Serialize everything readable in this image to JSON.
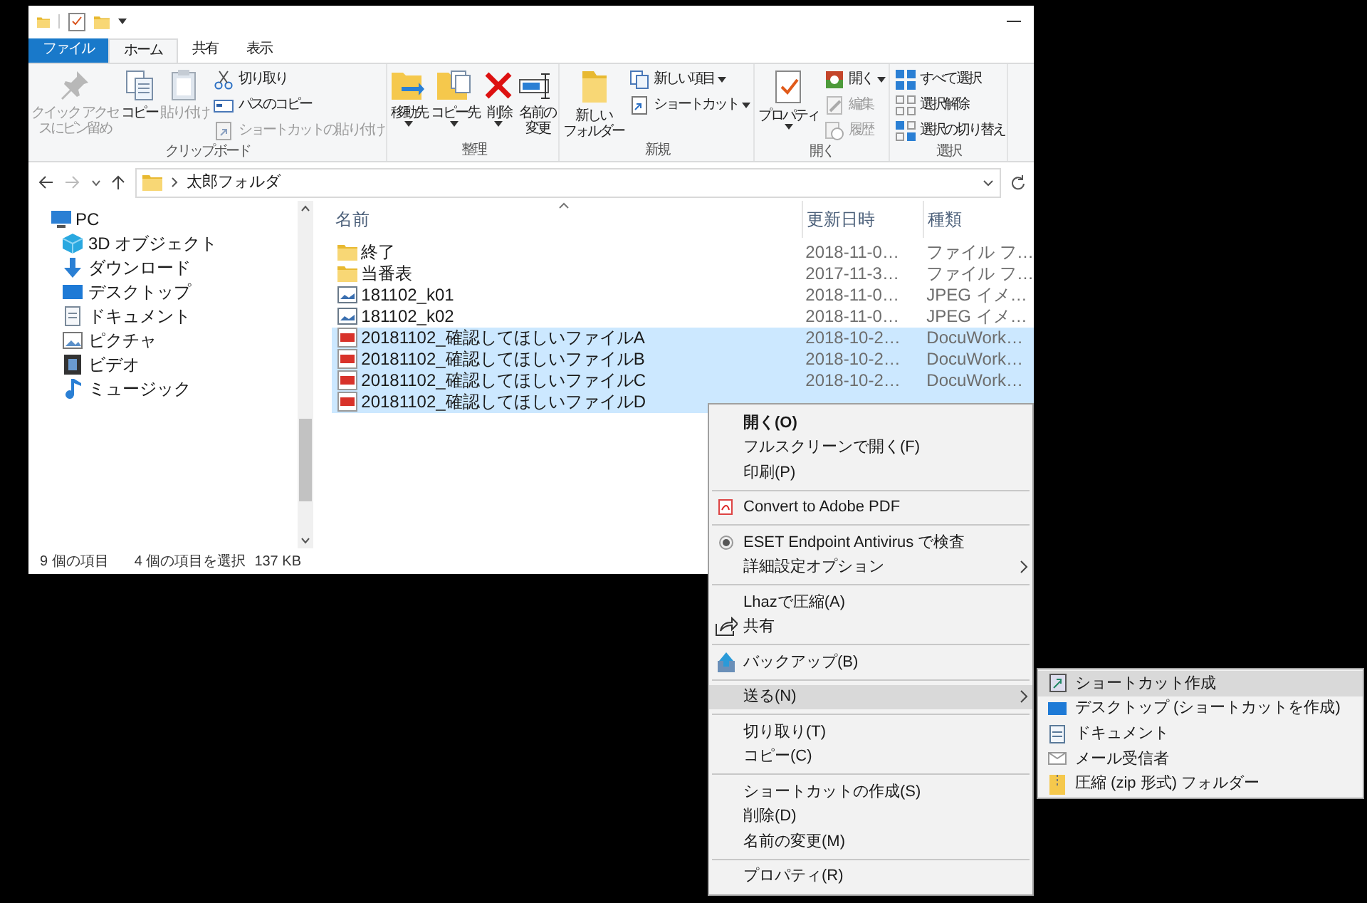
{
  "tabs": [
    {
      "label": "ファイル",
      "kind": "file",
      "selected": false
    },
    {
      "label": "ホーム",
      "kind": "tab",
      "selected": true
    },
    {
      "label": "共有",
      "kind": "tab",
      "selected": false
    },
    {
      "label": "表示",
      "kind": "tab",
      "selected": false
    }
  ],
  "ribbon": [
    {
      "label": "クリップボード",
      "items": [
        {
          "kind": "large",
          "label": [
            "クイック アクセ",
            "スにピン留め"
          ],
          "disabled": true,
          "dropdown": false
        },
        {
          "kind": "large",
          "label": [
            "コピー"
          ],
          "disabled": false,
          "dropdown": false
        },
        {
          "kind": "large",
          "label": [
            "貼り付け"
          ],
          "disabled": true,
          "dropdown": false
        },
        {
          "kind": "stack",
          "items": [
            {
              "label": "切り取り",
              "disabled": false,
              "dropdown": false
            },
            {
              "label": "パスのコピー",
              "disabled": false,
              "dropdown": false
            },
            {
              "label": "ショートカットの貼り付け",
              "disabled": true,
              "dropdown": false
            }
          ]
        }
      ]
    },
    {
      "label": "整理",
      "items": [
        {
          "kind": "large",
          "label": [
            "移動先"
          ],
          "disabled": false,
          "dropdown": true
        },
        {
          "kind": "large",
          "label": [
            "コピー先"
          ],
          "disabled": false,
          "dropdown": true
        },
        {
          "kind": "large",
          "label": [
            "削除"
          ],
          "disabled": false,
          "dropdown": true
        },
        {
          "kind": "large",
          "label": [
            "名前の",
            "変更"
          ],
          "disabled": false,
          "dropdown": false
        }
      ]
    },
    {
      "label": "新規",
      "items": [
        {
          "kind": "large",
          "label": [
            "新しい",
            "フォルダー"
          ],
          "disabled": false,
          "dropdown": false
        },
        {
          "kind": "stack",
          "items": [
            {
              "label": "新しい項目",
              "disabled": false,
              "dropdown": true
            },
            {
              "label": "ショートカット",
              "disabled": false,
              "dropdown": true
            }
          ]
        }
      ]
    },
    {
      "label": "開く",
      "items": [
        {
          "kind": "large",
          "label": [
            "プロパティ"
          ],
          "disabled": false,
          "dropdown": true
        },
        {
          "kind": "stack",
          "items": [
            {
              "label": "開く",
              "disabled": false,
              "dropdown": true
            },
            {
              "label": "編集",
              "disabled": true,
              "dropdown": false
            },
            {
              "label": "履歴",
              "disabled": true,
              "dropdown": false
            }
          ]
        }
      ]
    },
    {
      "label": "選択",
      "items": [
        {
          "kind": "stack",
          "items": [
            {
              "label": "すべて選択",
              "disabled": false,
              "dropdown": false
            },
            {
              "label": "選択解除",
              "disabled": false,
              "dropdown": false
            },
            {
              "label": "選択の切り替え",
              "disabled": false,
              "dropdown": false
            }
          ]
        }
      ]
    }
  ],
  "address": {
    "path": "太郎フォルダ"
  },
  "nav": [
    {
      "label": "PC",
      "children": [
        {
          "label": "3D オブジェクト"
        },
        {
          "label": "ダウンロード"
        },
        {
          "label": "デスクトップ"
        },
        {
          "label": "ドキュメント"
        },
        {
          "label": "ピクチャ"
        },
        {
          "label": "ビデオ"
        },
        {
          "label": "ミュージック"
        }
      ]
    }
  ],
  "file_list": {
    "columns": [
      "名前",
      "更新日時",
      "種類"
    ],
    "rows": [
      {
        "kind": "folder",
        "name": "終了",
        "date": "2018-11-0…",
        "type": "ファイル フ…",
        "selected": false
      },
      {
        "kind": "folder",
        "name": "当番表",
        "date": "2017-11-3…",
        "type": "ファイル フ…",
        "selected": false
      },
      {
        "kind": "image",
        "name": "181102_k01",
        "date": "2018-11-0…",
        "type": "JPEG イメ…",
        "selected": false
      },
      {
        "kind": "image",
        "name": "181102_k02",
        "date": "2018-11-0…",
        "type": "JPEG イメ…",
        "selected": false
      },
      {
        "kind": "docuworks",
        "name": "20181102_確認してほしいファイルA",
        "date": "2018-10-2…",
        "type": "DocuWork…",
        "selected": true
      },
      {
        "kind": "docuworks",
        "name": "20181102_確認してほしいファイルB",
        "date": "2018-10-2…",
        "type": "DocuWork…",
        "selected": true
      },
      {
        "kind": "docuworks",
        "name": "20181102_確認してほしいファイルC",
        "date": "2018-10-2…",
        "type": "DocuWork…",
        "selected": true
      },
      {
        "kind": "docuworks",
        "name": "20181102_確認してほしいファイルD",
        "selected": true
      }
    ]
  },
  "status_bar": {
    "item_count": "9 個の項目",
    "selection": "4 個の項目を選択",
    "size": "137 KB"
  },
  "context_menu": {
    "sections": [
      [
        {
          "label": "開く(O)",
          "default": true,
          "submenu": false,
          "selected": false
        },
        {
          "label": "フルスクリーンで開く(F)",
          "default": false,
          "submenu": false,
          "selected": false
        },
        {
          "label": "印刷(P)",
          "default": false,
          "submenu": false,
          "selected": false
        }
      ],
      [
        {
          "label": "Convert to Adobe PDF",
          "default": false,
          "submenu": false,
          "selected": false
        }
      ],
      [
        {
          "label": "ESET Endpoint Antivirus で検査",
          "default": false,
          "submenu": false,
          "selected": false
        },
        {
          "label": "詳細設定オプション",
          "default": false,
          "submenu": true,
          "selected": false
        }
      ],
      [
        {
          "label": "Lhazで圧縮(A)",
          "default": false,
          "submenu": false,
          "selected": false
        },
        {
          "label": "共有",
          "default": false,
          "submenu": false,
          "selected": false
        }
      ],
      [
        {
          "label": "バックアップ(B)",
          "default": false,
          "submenu": false,
          "selected": false
        }
      ],
      [
        {
          "label": "送る(N)",
          "default": false,
          "submenu": true,
          "selected": true
        }
      ],
      [
        {
          "label": "切り取り(T)",
          "default": false,
          "submenu": false,
          "selected": false
        },
        {
          "label": "コピー(C)",
          "default": false,
          "submenu": false,
          "selected": false
        }
      ],
      [
        {
          "label": "ショートカットの作成(S)",
          "default": false,
          "submenu": false,
          "selected": false
        },
        {
          "label": "削除(D)",
          "default": false,
          "submenu": false,
          "selected": false
        },
        {
          "label": "名前の変更(M)",
          "default": false,
          "submenu": false,
          "selected": false
        }
      ],
      [
        {
          "label": "プロパティ(R)",
          "default": false,
          "submenu": false,
          "selected": false
        }
      ]
    ]
  },
  "submenu": {
    "items": [
      {
        "label": "ショートカット作成",
        "selected": true
      },
      {
        "label": "デスクトップ (ショートカットを作成)",
        "selected": false
      },
      {
        "label": "ドキュメント",
        "selected": false
      },
      {
        "label": "メール受信者",
        "selected": false
      },
      {
        "label": "圧縮 (zip 形式) フォルダー",
        "selected": false
      }
    ]
  }
}
